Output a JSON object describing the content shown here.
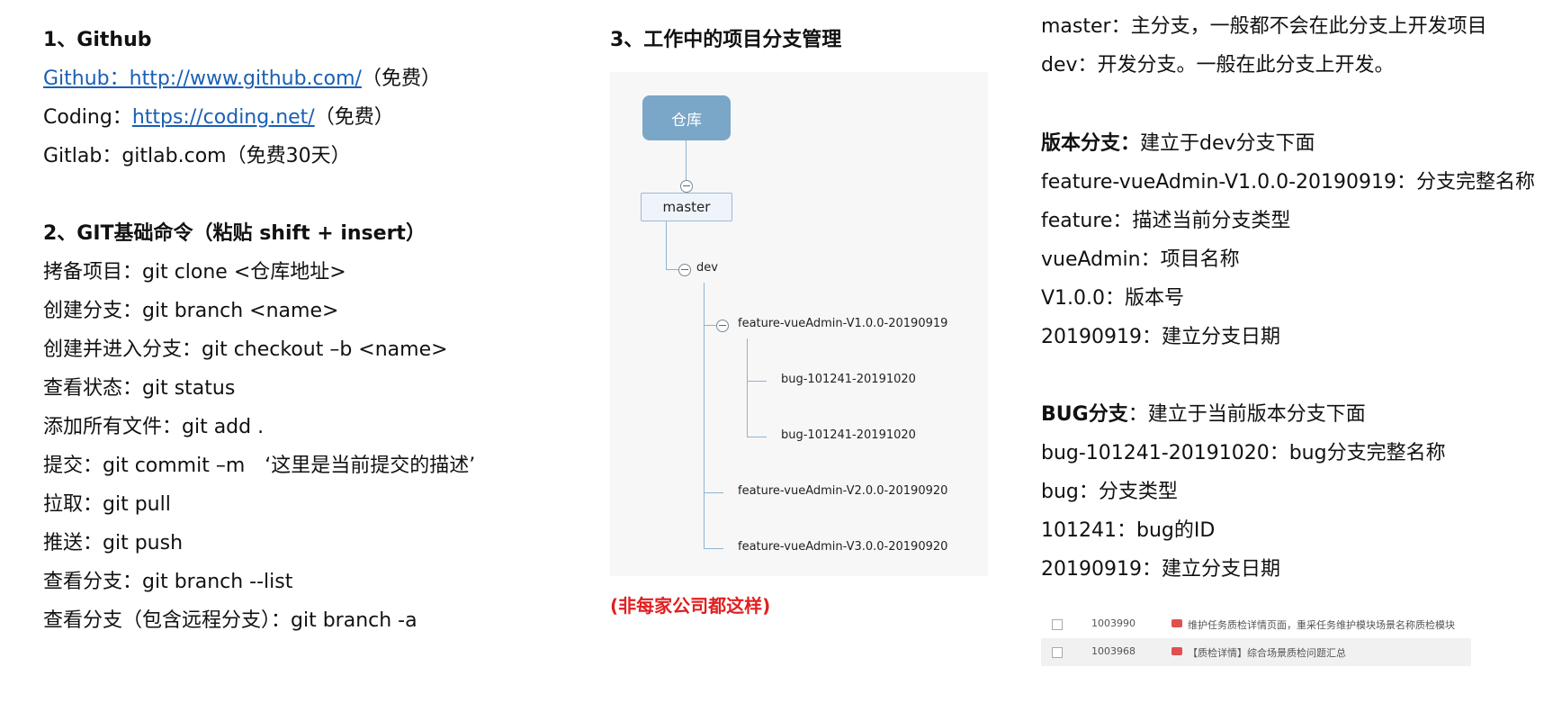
{
  "col1": {
    "heading1": "1、Github",
    "github_prefix": "Github：",
    "github_link": "Github：http://www.github.com/",
    "github_suffix": "（免费）",
    "coding_prefix": "Coding：",
    "coding_link": "https://coding.net/",
    "coding_suffix": "（免费）",
    "gitlab": "Gitlab：gitlab.com（免费30天）",
    "heading2": "2、GIT基础命令（粘贴 shift + insert）",
    "commands": [
      "拷备项目：git clone <仓库地址>",
      "创建分支：git branch <name>",
      "创建并进入分支：git checkout –b <name>",
      "查看状态：git status",
      "添加所有文件：git add .",
      "提交：git commit –m　‘这里是当前提交的描述’",
      "拉取：git pull",
      "推送：git push",
      "查看分支：git branch --list",
      "查看分支（包含远程分支）：git branch -a"
    ]
  },
  "col2": {
    "heading3": "3、工作中的项目分支管理",
    "diagram": {
      "repo": "仓库",
      "master": "master",
      "dev": "dev",
      "feature1": "feature-vueAdmin-V1.0.0-20190919",
      "bug1": "bug-101241-20191020",
      "bug2": "bug-101241-20191020",
      "feature2": "feature-vueAdmin-V2.0.0-20190920",
      "feature3": "feature-vueAdmin-V3.0.0-20190920"
    },
    "note": "(非每家公司都这样)"
  },
  "col3": {
    "master_desc": "master：主分支，一般都不会在此分支上开发项目",
    "dev_desc": "dev：开发分支。一般在此分支上开发。",
    "version_title": "版本分支：",
    "version_rest": "建立于dev分支下面",
    "version_lines": [
      "feature-vueAdmin-V1.0.0-20190919：分支完整名称",
      "feature：描述当前分支类型",
      "vueAdmin：项目名称",
      "V1.0.0：版本号",
      "20190919：建立分支日期"
    ],
    "bug_title": "BUG分支",
    "bug_rest": "：建立于当前版本分支下面",
    "bug_lines": [
      "bug-101241-20191020：bug分支完整名称",
      "bug：分支类型",
      "101241：bug的ID",
      "20190919：建立分支日期"
    ]
  },
  "tasks": [
    {
      "id": "1003990",
      "title": "维护任务质检详情页面，重采任务维护模块场景名称质检模块"
    },
    {
      "id": "1003968",
      "title": "【质检详情】综合场景质检问题汇总"
    }
  ],
  "colors": {
    "link": "#1a5fb4",
    "note": "#e02020",
    "repo_node": "#7aa6c7"
  }
}
